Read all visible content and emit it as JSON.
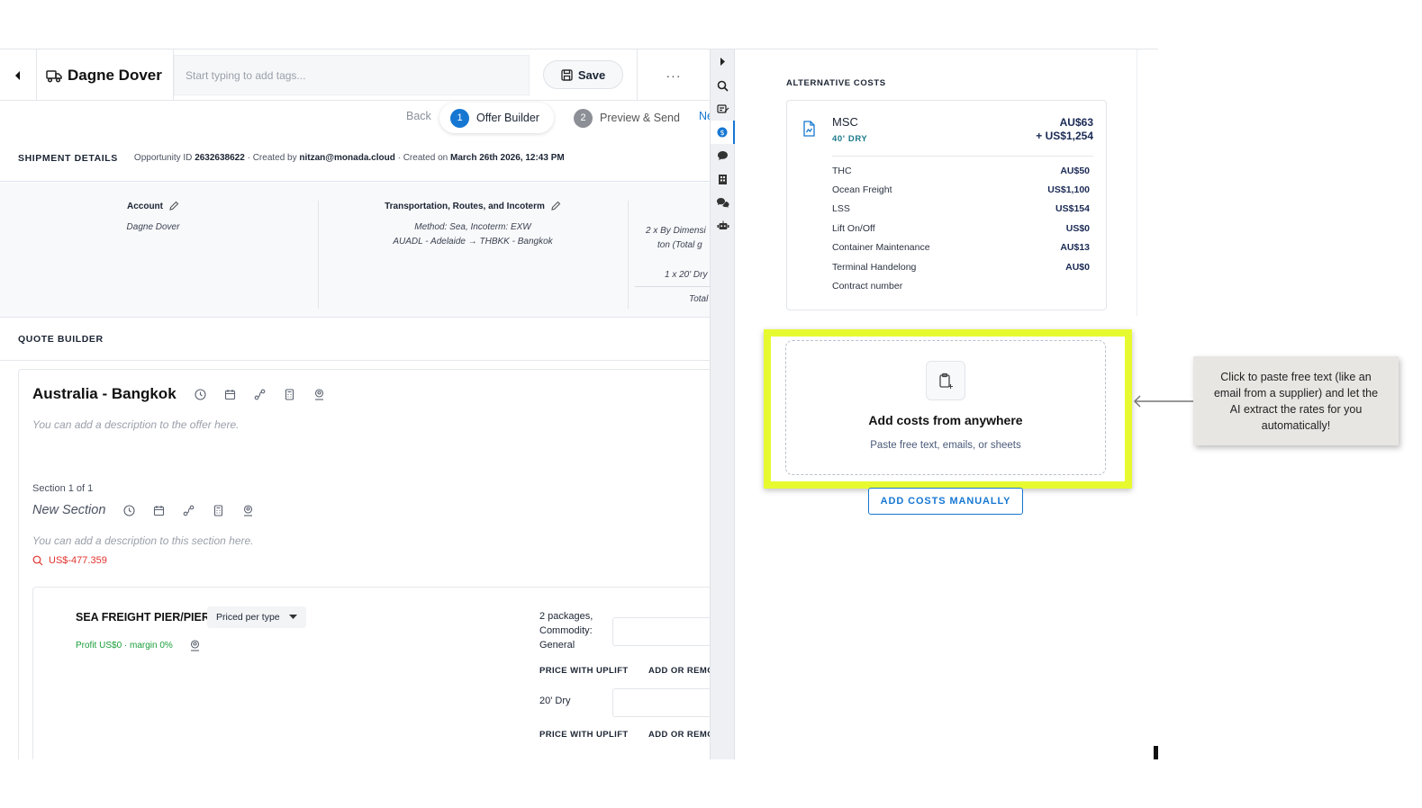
{
  "header": {
    "title": "Dagne Dover",
    "tags_placeholder": "Start typing to add tags...",
    "save_label": "Save",
    "more_label": "···"
  },
  "stepper": {
    "back_label": "Back",
    "steps": [
      {
        "number": "1",
        "label": "Offer Builder",
        "active": true
      },
      {
        "number": "2",
        "label": "Preview & Send",
        "active": false
      }
    ],
    "next_label": "Ne"
  },
  "shipment": {
    "section_title": "SHIPMENT DETAILS",
    "opportunity_prefix": "Opportunity ID ",
    "opportunity_id": "2632638622",
    "created_by_prefix": " · Created by ",
    "created_by": "nitzan@monada.cloud",
    "created_on_prefix": " · Created on ",
    "created_on": "March 26th 2026, 12:43 PM",
    "account": {
      "label": "Account",
      "value": "Dagne Dover"
    },
    "transport": {
      "label": "Transportation, Routes, and Incoterm",
      "line1": "Method: Sea, Incoterm: EXW",
      "line2": "AUADL - Adelaide → THBKK - Bangkok"
    },
    "cargo": {
      "line1": "2 x By Dimensi",
      "line2": "ton (Total g",
      "line3": "1 x 20' Dry",
      "line4": "Total"
    }
  },
  "quote": {
    "section_title": "QUOTE BUILDER",
    "offer_title": "Australia - Bangkok",
    "offer_desc": "You can add a description to the offer here.",
    "section_count": "Section 1 of 1",
    "section_title_text": "New Section",
    "section_desc": "You can add a description to this section here.",
    "section_price": "US$-477.359",
    "freight": {
      "title": "SEA FREIGHT PIER/PIER",
      "priced_select": "Priced per type",
      "profit": "Profit US$0 · margin 0%",
      "packages_label": "2 packages, Commodity: General",
      "col_price_uplift": "PRICE WITH UPLIFT",
      "col_add_remove": "ADD OR REMO",
      "dry_label": "20' Dry"
    }
  },
  "alternative_costs": {
    "title": "ALTERNATIVE COSTS",
    "carrier": "MSC",
    "container": "40' DRY",
    "total_aud": "AU$63",
    "total_usd": "+ US$1,254",
    "items": [
      {
        "name": "THC",
        "amount": "AU$50"
      },
      {
        "name": "Ocean Freight",
        "amount": "US$1,100"
      },
      {
        "name": "LSS",
        "amount": "US$154"
      },
      {
        "name": "Lift On/Off",
        "amount": "US$0"
      },
      {
        "name": "Container Maintenance",
        "amount": "AU$13"
      },
      {
        "name": "Terminal Handelong",
        "amount": "AU$0"
      },
      {
        "name": "Contract number",
        "amount": ""
      }
    ]
  },
  "dropzone": {
    "title": "Add costs from anywhere",
    "subtitle": "Paste free text, emails, or sheets"
  },
  "manual_button": "ADD COSTS MANUALLY",
  "tooltip": "Click to paste free text (like an email from a supplier) and let the AI extract the rates for you automatically!",
  "colors": {
    "accent": "#1677d2",
    "highlight": "#e7fa30",
    "negative": "#e0322d",
    "profit": "#1a9e3a"
  },
  "icons": {
    "collapse": "caret-left-icon",
    "truck": "truck-icon",
    "save": "save-icon",
    "sidebar": [
      "caret-right-icon",
      "search-zoom-icon",
      "tag-edit-icon",
      "dollar-circle-icon",
      "chat-dollar-icon",
      "building-icon",
      "chat-bubbles-icon",
      "robot-icon"
    ]
  }
}
